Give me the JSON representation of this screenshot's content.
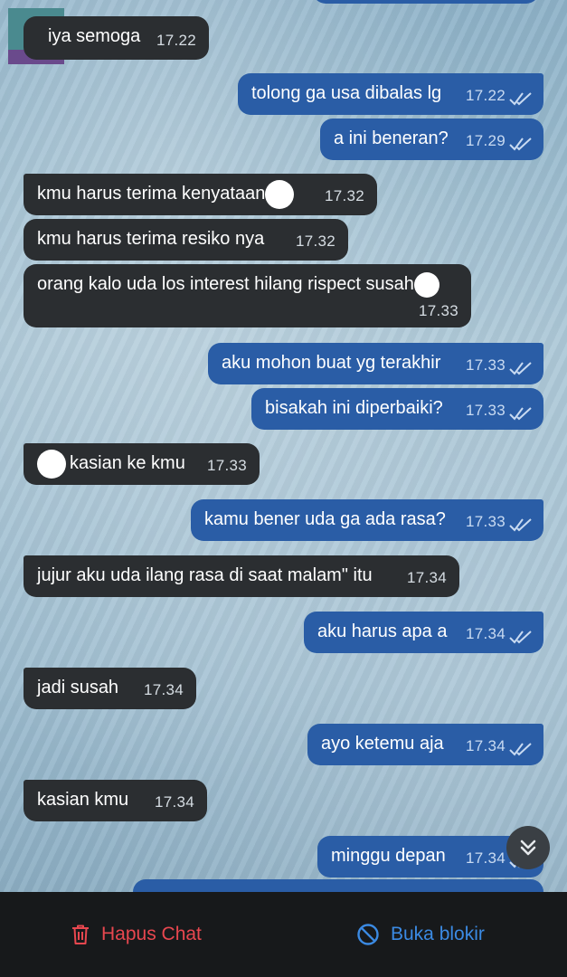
{
  "messages": [
    {
      "text": "iya semoga",
      "time": "17.22",
      "direction": "in"
    },
    {
      "text": "tolong ga usa dibalas lg",
      "time": "17.22",
      "direction": "out",
      "status": "read"
    },
    {
      "text": "a ini beneran?",
      "time": "17.29",
      "direction": "out",
      "status": "read"
    },
    {
      "text": "kmu harus terima kenyataan",
      "time": "17.32",
      "direction": "in"
    },
    {
      "text": "kmu harus terima resiko nya",
      "time": "17.32",
      "direction": "in"
    },
    {
      "text": "orang kalo uda los interest hilang rispect susah",
      "time": "17.33",
      "direction": "in"
    },
    {
      "text": "aku mohon buat yg terakhir",
      "time": "17.33",
      "direction": "out",
      "status": "read"
    },
    {
      "text": "bisakah ini diperbaiki?",
      "time": "17.33",
      "direction": "out",
      "status": "read"
    },
    {
      "text": "kasian ke kmu",
      "time": "17.33",
      "direction": "in"
    },
    {
      "text": "kamu bener uda ga ada rasa?",
      "time": "17.33",
      "direction": "out",
      "status": "read"
    },
    {
      "text": "jujur aku uda ilang rasa di saat malam\" itu",
      "time": "17.34",
      "direction": "in"
    },
    {
      "text": "aku harus apa a",
      "time": "17.34",
      "direction": "out",
      "status": "read"
    },
    {
      "text": "jadi susah",
      "time": "17.34",
      "direction": "in"
    },
    {
      "text": "ayo ketemu aja",
      "time": "17.34",
      "direction": "out",
      "status": "read"
    },
    {
      "text": "kasian kmu",
      "time": "17.34",
      "direction": "in"
    },
    {
      "text": "minggu depan",
      "time": "17.34",
      "direction": "out",
      "status": "read"
    }
  ],
  "actions": {
    "delete_label": "Hapus Chat",
    "unblock_label": "Buka blokir"
  },
  "icons": {
    "read_ticks": "double-check-icon",
    "scroll_down": "chevrons-down-icon",
    "delete": "trash-icon",
    "unblock": "block-icon"
  },
  "colors": {
    "incoming_bubble": "#2b2e31",
    "outgoing_bubble": "#2a5da6",
    "delete_action": "#e8474f",
    "unblock_action": "#3b8ae3",
    "bottom_bar": "#17191b"
  }
}
